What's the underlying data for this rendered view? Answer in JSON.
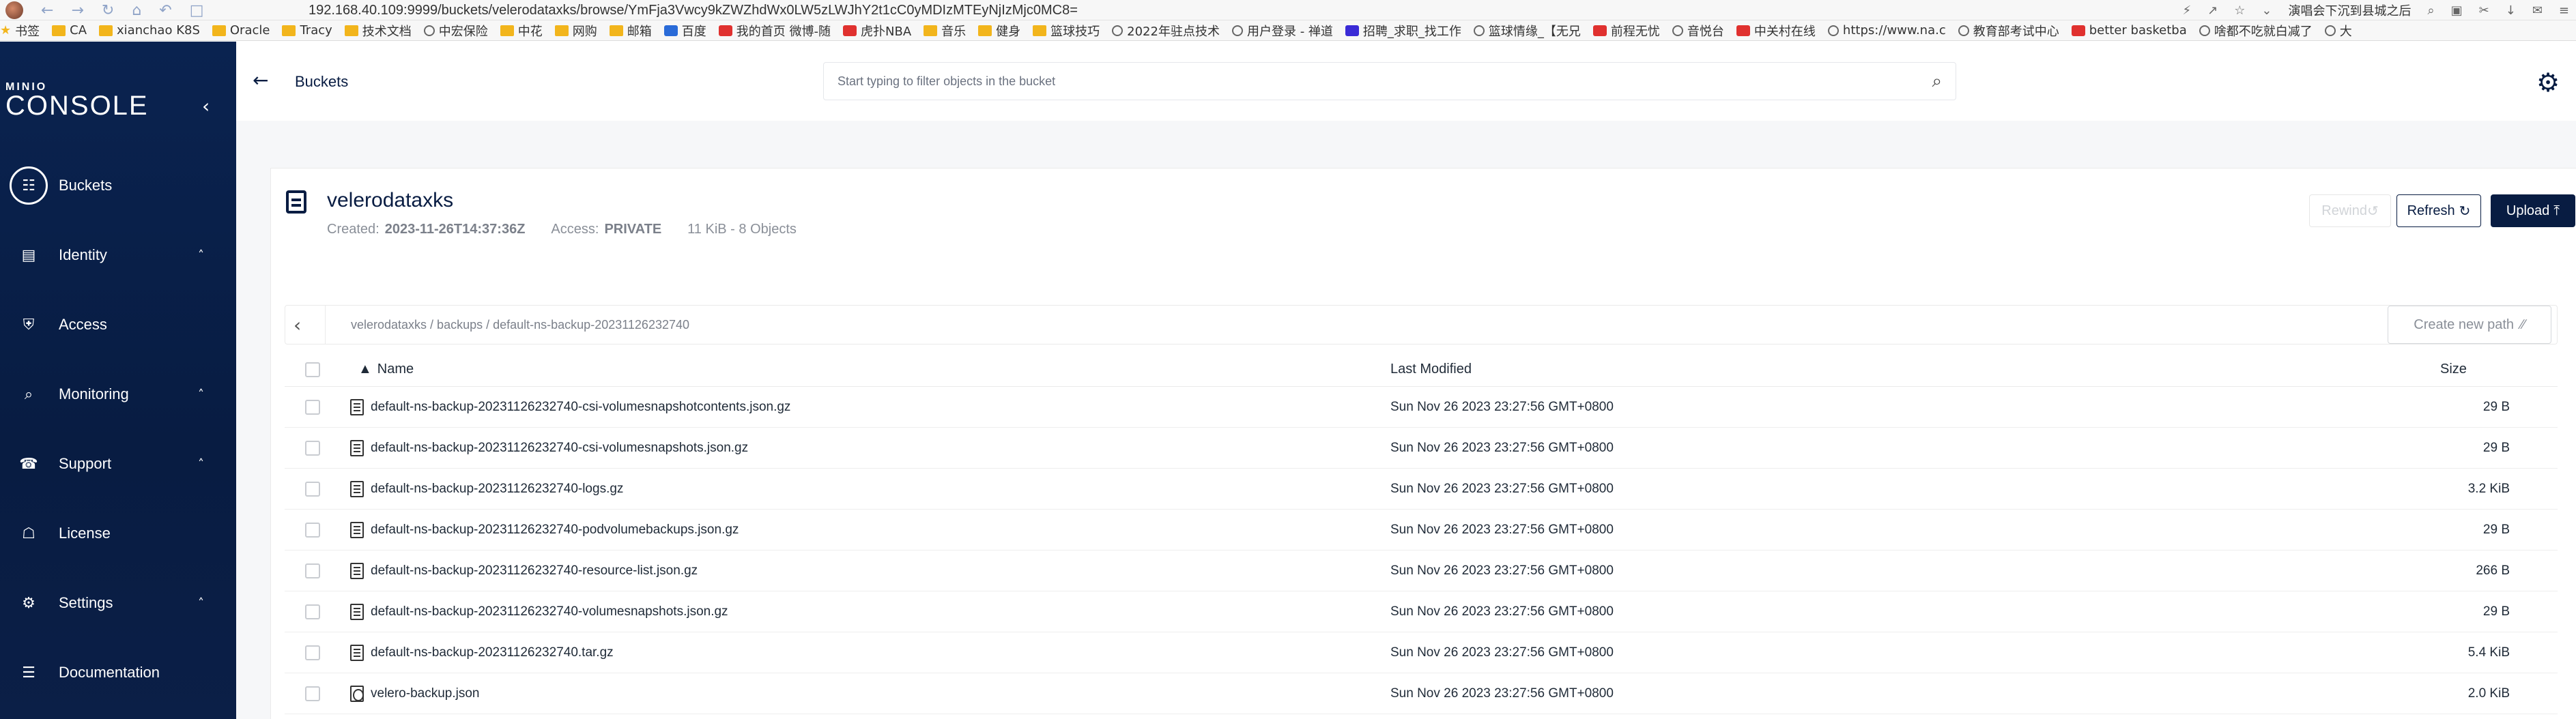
{
  "browser": {
    "url": "192.168.40.109:9999/buckets/velerodataxks/browse/YmFja3Vwcy9kZWZhdWx0LW5zLWJhY2t1cC0yMDIzMTEyNjIzMjc0MC8=",
    "hot_search": "演唱会下沉到县城之后",
    "bookmarks": [
      {
        "label": "书签",
        "icon": "star-icon"
      },
      {
        "label": "CA",
        "icon": "folder-icon"
      },
      {
        "label": "xianchao K8S",
        "icon": "folder-icon"
      },
      {
        "label": "Oracle",
        "icon": "folder-icon"
      },
      {
        "label": "Tracy",
        "icon": "folder-icon"
      },
      {
        "label": "技术文档",
        "icon": "folder-icon"
      },
      {
        "label": "中宏保险",
        "icon": "globe-icon"
      },
      {
        "label": "中花",
        "icon": "folder-icon"
      },
      {
        "label": "网购",
        "icon": "folder-icon"
      },
      {
        "label": "邮箱",
        "icon": "folder-icon"
      },
      {
        "label": "百度",
        "icon": "blue-icon"
      },
      {
        "label": "我的首页 微博-随",
        "icon": "red-icon"
      },
      {
        "label": "虎扑NBA",
        "icon": "red-icon"
      },
      {
        "label": "音乐",
        "icon": "folder-icon"
      },
      {
        "label": "健身",
        "icon": "folder-icon"
      },
      {
        "label": "篮球技巧",
        "icon": "folder-icon"
      },
      {
        "label": "2022年驻点技术",
        "icon": "globe-icon"
      },
      {
        "label": "用户登录 - 禅道",
        "icon": "globe-icon"
      },
      {
        "label": "招聘_求职_找工作",
        "icon": "purple-icon"
      },
      {
        "label": "篮球情缘_【无兄",
        "icon": "globe-icon"
      },
      {
        "label": "前程无忧",
        "icon": "red-icon"
      },
      {
        "label": "音悦台",
        "icon": "globe-icon"
      },
      {
        "label": "中关村在线",
        "icon": "red-icon"
      },
      {
        "label": "https://www.na.c",
        "icon": "globe-icon"
      },
      {
        "label": "教育部考试中心",
        "icon": "globe-icon"
      },
      {
        "label": "better basketba",
        "icon": "red-icon"
      },
      {
        "label": "啥都不吃就白减了",
        "icon": "globe-icon"
      },
      {
        "label": "大",
        "icon": "globe-icon"
      }
    ]
  },
  "sidebar": {
    "logo_top": "MINIO",
    "logo_bottom": "CONSOLE",
    "items": [
      {
        "label": "Buckets",
        "icon": "bucket-icon",
        "active": true,
        "caret": ""
      },
      {
        "label": "Identity",
        "icon": "id-card-icon",
        "active": false,
        "caret": "^"
      },
      {
        "label": "Access",
        "icon": "shield-icon",
        "active": false,
        "caret": ""
      },
      {
        "label": "Monitoring",
        "icon": "magnifier-icon",
        "active": false,
        "caret": "^"
      },
      {
        "label": "Support",
        "icon": "support-icon",
        "active": false,
        "caret": "^"
      },
      {
        "label": "License",
        "icon": "license-icon",
        "active": false,
        "caret": ""
      },
      {
        "label": "Settings",
        "icon": "gear-icon",
        "active": false,
        "caret": "^"
      },
      {
        "label": "Documentation",
        "icon": "document-icon",
        "active": false,
        "caret": ""
      }
    ]
  },
  "topbar": {
    "back_label": "Buckets",
    "search_placeholder": "Start typing to filter objects in the bucket"
  },
  "bucket": {
    "name": "velerodataxks",
    "created_label": "Created:",
    "created_value": "2023-11-26T14:37:36Z",
    "access_label": "Access:",
    "access_value": "PRIVATE",
    "summary": "11 KiB - 8 Objects",
    "rewind_label": "Rewind",
    "refresh_label": "Refresh",
    "upload_label": "Upload"
  },
  "path": {
    "text": "velerodataxks / backups / default-ns-backup-20231126232740",
    "new_path_label": "Create new path"
  },
  "table": {
    "headers": {
      "name": "Name",
      "modified": "Last Modified",
      "size": "Size"
    },
    "rows": [
      {
        "name": "default-ns-backup-20231126232740-csi-volumesnapshotcontents.json.gz",
        "modified": "Sun Nov 26 2023 23:27:56 GMT+0800",
        "size": "29 B",
        "icon": "file-icon"
      },
      {
        "name": "default-ns-backup-20231126232740-csi-volumesnapshots.json.gz",
        "modified": "Sun Nov 26 2023 23:27:56 GMT+0800",
        "size": "29 B",
        "icon": "file-icon"
      },
      {
        "name": "default-ns-backup-20231126232740-logs.gz",
        "modified": "Sun Nov 26 2023 23:27:56 GMT+0800",
        "size": "3.2 KiB",
        "icon": "file-icon"
      },
      {
        "name": "default-ns-backup-20231126232740-podvolumebackups.json.gz",
        "modified": "Sun Nov 26 2023 23:27:56 GMT+0800",
        "size": "29 B",
        "icon": "file-icon"
      },
      {
        "name": "default-ns-backup-20231126232740-resource-list.json.gz",
        "modified": "Sun Nov 26 2023 23:27:56 GMT+0800",
        "size": "266 B",
        "icon": "file-icon"
      },
      {
        "name": "default-ns-backup-20231126232740-volumesnapshots.json.gz",
        "modified": "Sun Nov 26 2023 23:27:56 GMT+0800",
        "size": "29 B",
        "icon": "file-icon"
      },
      {
        "name": "default-ns-backup-20231126232740.tar.gz",
        "modified": "Sun Nov 26 2023 23:27:56 GMT+0800",
        "size": "5.4 KiB",
        "icon": "file-icon"
      },
      {
        "name": "velero-backup.json",
        "modified": "Sun Nov 26 2023 23:27:56 GMT+0800",
        "size": "2.0 KiB",
        "icon": "json-file-icon"
      }
    ]
  },
  "colors": {
    "brand": "#081c42",
    "sidebar_bg": "#081c42"
  }
}
